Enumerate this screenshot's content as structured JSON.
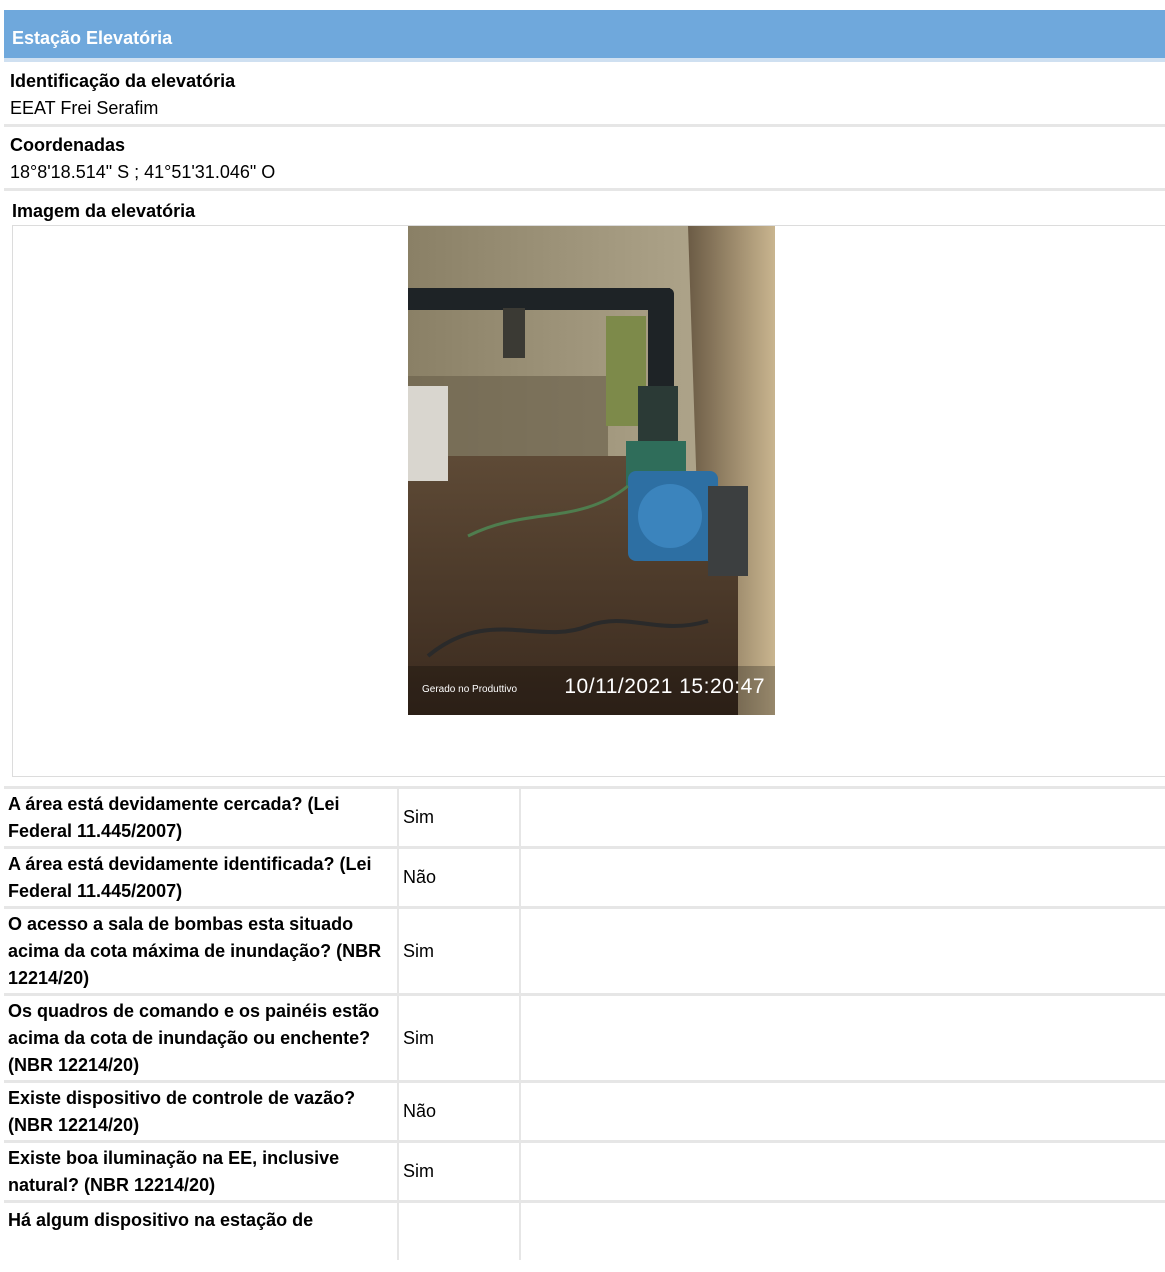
{
  "header": {
    "title": "Estação Elevatória"
  },
  "identificacao": {
    "label": "Identificação da elevatória",
    "value": "EEAT Frei Serafim"
  },
  "coordenadas": {
    "label": "Coordenadas",
    "value": "18°8'18.514\" S ; 41°51'31.046\" O"
  },
  "imagem": {
    "label": "Imagem da elevatória",
    "stamp_small": "Gerado no Produttivo",
    "stamp_datetime": "10/11/2021 15:20:47"
  },
  "questions": [
    {
      "question": "A área está devidamente cercada? (Lei Federal 11.445/2007)",
      "answer": "Sim"
    },
    {
      "question": "A área está devidamente identificada? (Lei Federal 11.445/2007)",
      "answer": "Não"
    },
    {
      "question": "O acesso a sala de bombas esta situado acima da cota máxima de inundação? (NBR 12214/20)",
      "answer": "Sim"
    },
    {
      "question": "Os quadros de comando e os painéis estão acima da cota de inundação ou enchente? (NBR 12214/20)",
      "answer": "Sim"
    },
    {
      "question": "Existe dispositivo de controle de vazão? (NBR 12214/20)",
      "answer": "Não"
    },
    {
      "question": "Existe boa iluminação na EE, inclusive natural? (NBR 12214/20)",
      "answer": "Sim"
    },
    {
      "question": "Há algum dispositivo na estação de",
      "answer": ""
    }
  ]
}
